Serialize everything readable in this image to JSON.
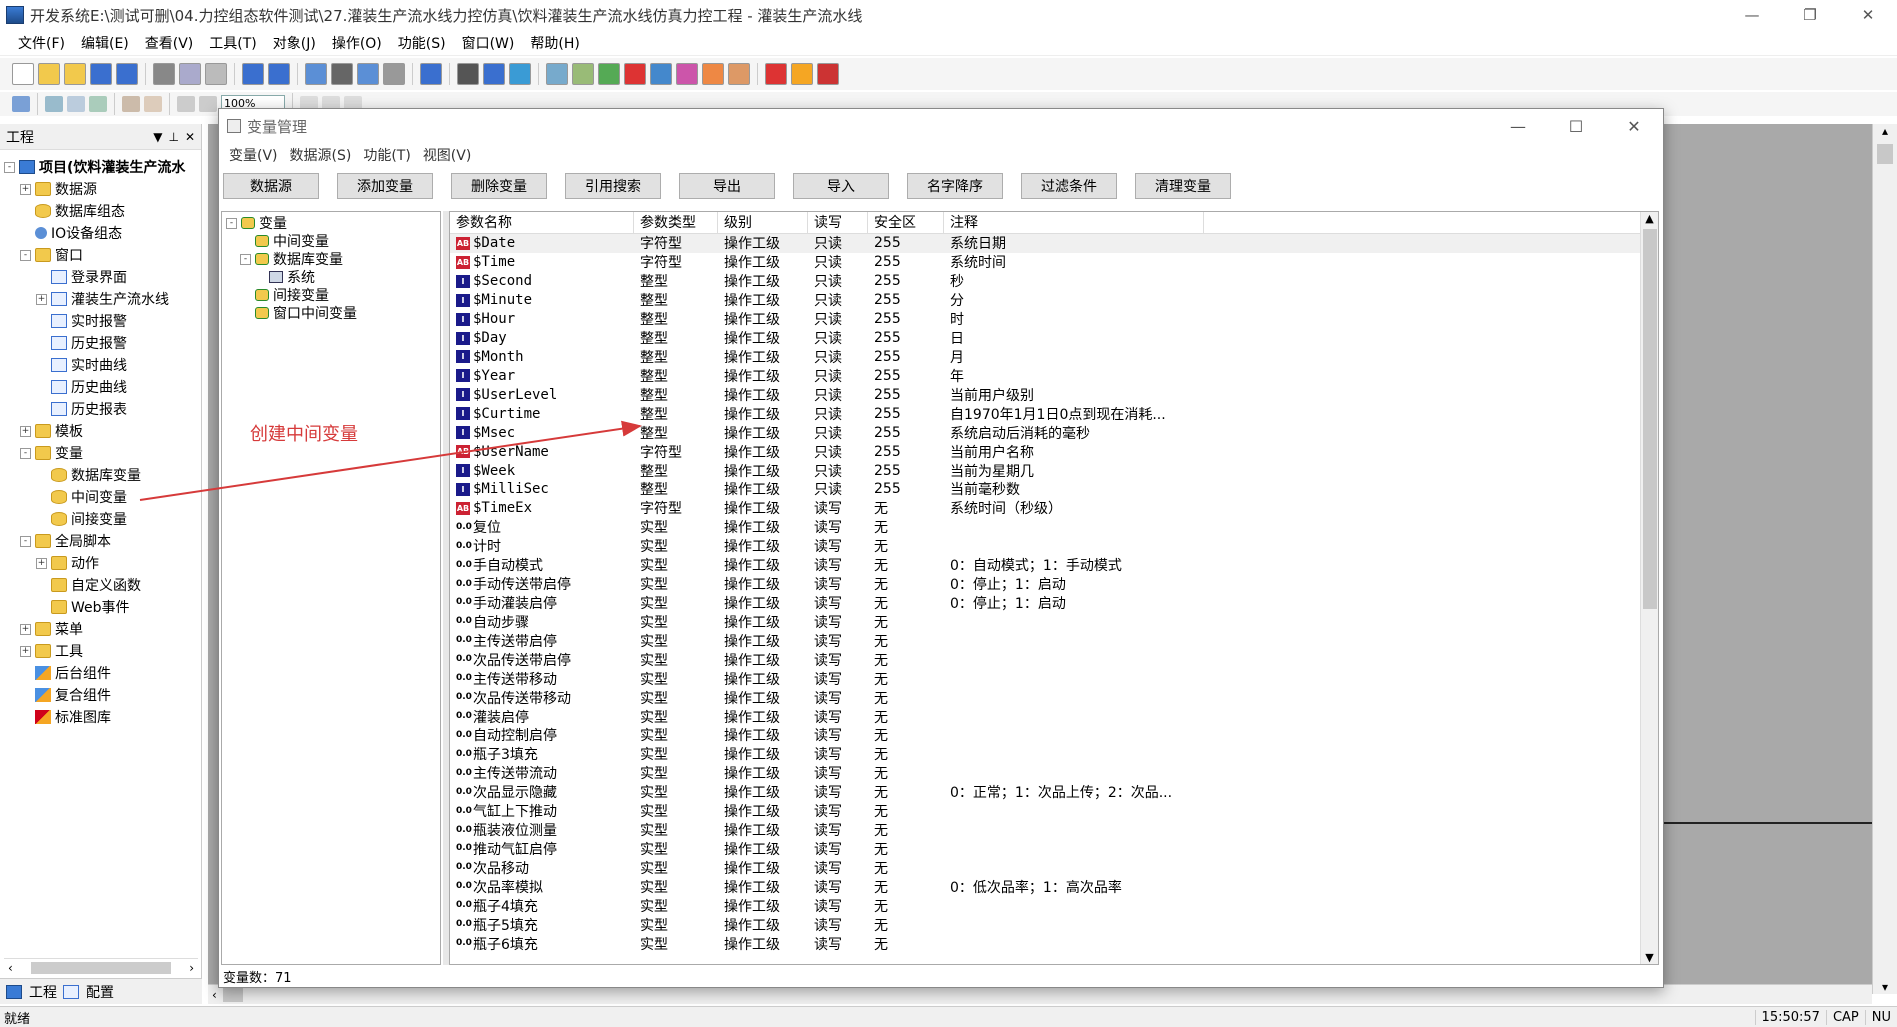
{
  "app": {
    "title": "开发系统E:\\测试可删\\04.力控组态软件测试\\27.灌装生产流水线力控仿真\\饮料灌装生产流水线仿真力控工程 - 灌装生产流水线"
  },
  "menubar": [
    "文件(F)",
    "编辑(E)",
    "查看(V)",
    "工具(T)",
    "对象(J)",
    "操作(O)",
    "功能(S)",
    "窗口(W)",
    "帮助(H)"
  ],
  "toolbar": {
    "zoom": "100%"
  },
  "left_panel": {
    "title": "工程",
    "tree": [
      {
        "label": "项目(饮料灌装生产流水",
        "level": 0,
        "exp": "-",
        "icon": "root",
        "bold": true
      },
      {
        "label": "数据源",
        "level": 1,
        "exp": "+",
        "icon": "folder"
      },
      {
        "label": "数据库组态",
        "level": 1,
        "exp": "",
        "icon": "db"
      },
      {
        "label": "IO设备组态",
        "level": 1,
        "exp": "",
        "icon": "io"
      },
      {
        "label": "窗口",
        "level": 1,
        "exp": "-",
        "icon": "folder"
      },
      {
        "label": "登录界面",
        "level": 2,
        "exp": "",
        "icon": "page"
      },
      {
        "label": "灌装生产流水线",
        "level": 2,
        "exp": "+",
        "icon": "page"
      },
      {
        "label": "实时报警",
        "level": 2,
        "exp": "",
        "icon": "page"
      },
      {
        "label": "历史报警",
        "level": 2,
        "exp": "",
        "icon": "page"
      },
      {
        "label": "实时曲线",
        "level": 2,
        "exp": "",
        "icon": "page"
      },
      {
        "label": "历史曲线",
        "level": 2,
        "exp": "",
        "icon": "page"
      },
      {
        "label": "历史报表",
        "level": 2,
        "exp": "",
        "icon": "page"
      },
      {
        "label": "模板",
        "level": 1,
        "exp": "+",
        "icon": "folder"
      },
      {
        "label": "变量",
        "level": 1,
        "exp": "-",
        "icon": "folder"
      },
      {
        "label": "数据库变量",
        "level": 2,
        "exp": "",
        "icon": "db"
      },
      {
        "label": "中间变量",
        "level": 2,
        "exp": "",
        "icon": "db"
      },
      {
        "label": "间接变量",
        "level": 2,
        "exp": "",
        "icon": "db"
      },
      {
        "label": "全局脚本",
        "level": 1,
        "exp": "-",
        "icon": "folder"
      },
      {
        "label": "动作",
        "level": 2,
        "exp": "+",
        "icon": "folder"
      },
      {
        "label": "自定义函数",
        "level": 2,
        "exp": "",
        "icon": "folder"
      },
      {
        "label": "Web事件",
        "level": 2,
        "exp": "",
        "icon": "folder"
      },
      {
        "label": "菜单",
        "level": 1,
        "exp": "+",
        "icon": "folder"
      },
      {
        "label": "工具",
        "level": 1,
        "exp": "+",
        "icon": "folder"
      },
      {
        "label": "后台组件",
        "level": 1,
        "exp": "",
        "icon": "comp"
      },
      {
        "label": "复合组件",
        "level": 1,
        "exp": "",
        "icon": "comp"
      },
      {
        "label": "标准图库",
        "level": 1,
        "exp": "",
        "icon": "lib"
      }
    ],
    "tabs": [
      "工程",
      "配置"
    ]
  },
  "dialog": {
    "title": "变量管理",
    "menu": [
      "变量(V)",
      "数据源(S)",
      "功能(T)",
      "视图(V)"
    ],
    "buttons": [
      "数据源",
      "添加变量",
      "删除变量",
      "引用搜索",
      "导出",
      "导入",
      "名字降序",
      "过滤条件",
      "清理变量"
    ],
    "tree": [
      {
        "label": "变量",
        "level": 0,
        "exp": "-"
      },
      {
        "label": "中间变量",
        "level": 1,
        "exp": ""
      },
      {
        "label": "数据库变量",
        "level": 1,
        "exp": "-"
      },
      {
        "label": "系统",
        "level": 2,
        "exp": "",
        "icon": "pc"
      },
      {
        "label": "间接变量",
        "level": 1,
        "exp": ""
      },
      {
        "label": "窗口中间变量",
        "level": 1,
        "exp": ""
      }
    ],
    "columns": [
      "参数名称",
      "参数类型",
      "级别",
      "读写",
      "安全区",
      "注释"
    ],
    "rows": [
      {
        "icon": "AB",
        "name": "$Date",
        "type": "字符型",
        "level": "操作工级",
        "rw": "只读",
        "safe": "255",
        "note": "系统日期"
      },
      {
        "icon": "AB",
        "name": "$Time",
        "type": "字符型",
        "level": "操作工级",
        "rw": "只读",
        "safe": "255",
        "note": "系统时间"
      },
      {
        "icon": "I",
        "name": "$Second",
        "type": "整型",
        "level": "操作工级",
        "rw": "只读",
        "safe": "255",
        "note": "秒"
      },
      {
        "icon": "I",
        "name": "$Minute",
        "type": "整型",
        "level": "操作工级",
        "rw": "只读",
        "safe": "255",
        "note": "分"
      },
      {
        "icon": "I",
        "name": "$Hour",
        "type": "整型",
        "level": "操作工级",
        "rw": "只读",
        "safe": "255",
        "note": "时"
      },
      {
        "icon": "I",
        "name": "$Day",
        "type": "整型",
        "level": "操作工级",
        "rw": "只读",
        "safe": "255",
        "note": "日"
      },
      {
        "icon": "I",
        "name": "$Month",
        "type": "整型",
        "level": "操作工级",
        "rw": "只读",
        "safe": "255",
        "note": "月"
      },
      {
        "icon": "I",
        "name": "$Year",
        "type": "整型",
        "level": "操作工级",
        "rw": "只读",
        "safe": "255",
        "note": "年"
      },
      {
        "icon": "I",
        "name": "$UserLevel",
        "type": "整型",
        "level": "操作工级",
        "rw": "只读",
        "safe": "255",
        "note": "当前用户级别"
      },
      {
        "icon": "I",
        "name": "$Curtime",
        "type": "整型",
        "level": "操作工级",
        "rw": "只读",
        "safe": "255",
        "note": "自1970年1月1日0点到现在消耗..."
      },
      {
        "icon": "I",
        "name": "$Msec",
        "type": "整型",
        "level": "操作工级",
        "rw": "只读",
        "safe": "255",
        "note": "系统启动后消耗的毫秒"
      },
      {
        "icon": "AB",
        "name": "$UserName",
        "type": "字符型",
        "level": "操作工级",
        "rw": "只读",
        "safe": "255",
        "note": "当前用户名称"
      },
      {
        "icon": "I",
        "name": "$Week",
        "type": "整型",
        "level": "操作工级",
        "rw": "只读",
        "safe": "255",
        "note": "当前为星期几"
      },
      {
        "icon": "I",
        "name": "$MilliSec",
        "type": "整型",
        "level": "操作工级",
        "rw": "只读",
        "safe": "255",
        "note": "当前毫秒数"
      },
      {
        "icon": "AB",
        "name": "$TimeEx",
        "type": "字符型",
        "level": "操作工级",
        "rw": "读写",
        "safe": "无",
        "note": "系统时间（秒级）"
      },
      {
        "icon": "0.0",
        "name": "复位",
        "type": "实型",
        "level": "操作工级",
        "rw": "读写",
        "safe": "无",
        "note": ""
      },
      {
        "icon": "0.0",
        "name": "计时",
        "type": "实型",
        "level": "操作工级",
        "rw": "读写",
        "safe": "无",
        "note": ""
      },
      {
        "icon": "0.0",
        "name": "手自动模式",
        "type": "实型",
        "level": "操作工级",
        "rw": "读写",
        "safe": "无",
        "note": "0：自动模式；1：手动模式"
      },
      {
        "icon": "0.0",
        "name": "手动传送带启停",
        "type": "实型",
        "level": "操作工级",
        "rw": "读写",
        "safe": "无",
        "note": "0：停止；1：启动"
      },
      {
        "icon": "0.0",
        "name": "手动灌装启停",
        "type": "实型",
        "level": "操作工级",
        "rw": "读写",
        "safe": "无",
        "note": "0：停止；1：启动"
      },
      {
        "icon": "0.0",
        "name": "自动步骤",
        "type": "实型",
        "level": "操作工级",
        "rw": "读写",
        "safe": "无",
        "note": ""
      },
      {
        "icon": "0.0",
        "name": "主传送带启停",
        "type": "实型",
        "level": "操作工级",
        "rw": "读写",
        "safe": "无",
        "note": ""
      },
      {
        "icon": "0.0",
        "name": "次品传送带启停",
        "type": "实型",
        "level": "操作工级",
        "rw": "读写",
        "safe": "无",
        "note": ""
      },
      {
        "icon": "0.0",
        "name": "主传送带移动",
        "type": "实型",
        "level": "操作工级",
        "rw": "读写",
        "safe": "无",
        "note": ""
      },
      {
        "icon": "0.0",
        "name": "次品传送带移动",
        "type": "实型",
        "level": "操作工级",
        "rw": "读写",
        "safe": "无",
        "note": ""
      },
      {
        "icon": "0.0",
        "name": "灌装启停",
        "type": "实型",
        "level": "操作工级",
        "rw": "读写",
        "safe": "无",
        "note": ""
      },
      {
        "icon": "0.0",
        "name": "自动控制启停",
        "type": "实型",
        "level": "操作工级",
        "rw": "读写",
        "safe": "无",
        "note": ""
      },
      {
        "icon": "0.0",
        "name": "瓶子3填充",
        "type": "实型",
        "level": "操作工级",
        "rw": "读写",
        "safe": "无",
        "note": ""
      },
      {
        "icon": "0.0",
        "name": "主传送带流动",
        "type": "实型",
        "level": "操作工级",
        "rw": "读写",
        "safe": "无",
        "note": ""
      },
      {
        "icon": "0.0",
        "name": "次品显示隐藏",
        "type": "实型",
        "level": "操作工级",
        "rw": "读写",
        "safe": "无",
        "note": "0：正常；1：次品上传；2：次品..."
      },
      {
        "icon": "0.0",
        "name": "气缸上下推动",
        "type": "实型",
        "level": "操作工级",
        "rw": "读写",
        "safe": "无",
        "note": ""
      },
      {
        "icon": "0.0",
        "name": "瓶装液位测量",
        "type": "实型",
        "level": "操作工级",
        "rw": "读写",
        "safe": "无",
        "note": ""
      },
      {
        "icon": "0.0",
        "name": "推动气缸启停",
        "type": "实型",
        "level": "操作工级",
        "rw": "读写",
        "safe": "无",
        "note": ""
      },
      {
        "icon": "0.0",
        "name": "次品移动",
        "type": "实型",
        "level": "操作工级",
        "rw": "读写",
        "safe": "无",
        "note": ""
      },
      {
        "icon": "0.0",
        "name": "次品率模拟",
        "type": "实型",
        "level": "操作工级",
        "rw": "读写",
        "safe": "无",
        "note": "0：低次品率；1：高次品率"
      },
      {
        "icon": "0.0",
        "name": "瓶子4填充",
        "type": "实型",
        "level": "操作工级",
        "rw": "读写",
        "safe": "无",
        "note": ""
      },
      {
        "icon": "0.0",
        "name": "瓶子5填充",
        "type": "实型",
        "level": "操作工级",
        "rw": "读写",
        "safe": "无",
        "note": ""
      },
      {
        "icon": "0.0",
        "name": "瓶子6填充",
        "type": "实型",
        "level": "操作工级",
        "rw": "读写",
        "safe": "无",
        "note": ""
      }
    ],
    "status": "变量数：71"
  },
  "annotation": {
    "text": "创建中间变量",
    "color": "#d63a3a"
  },
  "statusbar": {
    "left": "就绪",
    "time": "15:50:57",
    "caps": "CAP",
    "num": "NU"
  }
}
